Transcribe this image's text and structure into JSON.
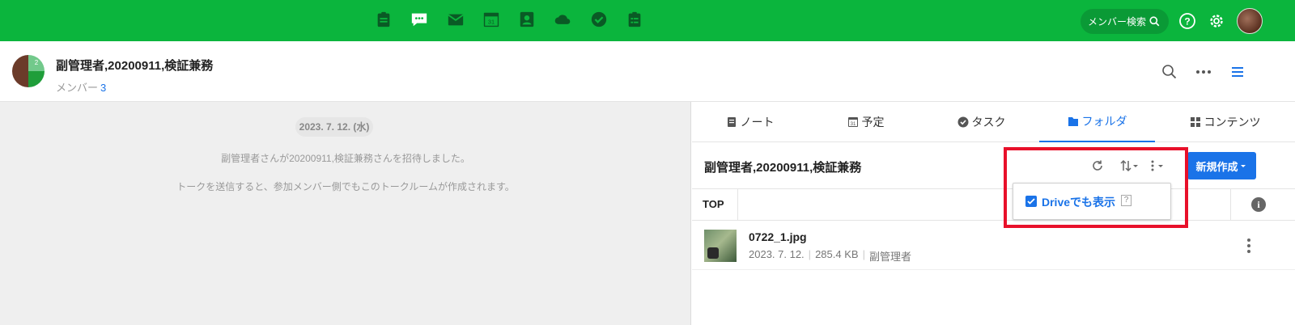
{
  "topbar": {
    "apps": [
      "note-app-icon",
      "talk-app-icon",
      "mail-app-icon",
      "calendar-app-icon",
      "contacts-app-icon",
      "drive-app-icon",
      "task-app-icon",
      "form-app-icon"
    ],
    "calendar_day": "31",
    "member_search_label": "メンバー検索",
    "colors": {
      "bar": "#0bb53d",
      "pill": "#0a9a36"
    }
  },
  "room": {
    "title": "副管理者,20200911,検証兼務",
    "member_label": "メンバー",
    "member_count": "3",
    "avatar_badge": "2"
  },
  "chat": {
    "date": "2023. 7. 12. (水)",
    "messages": [
      "副管理者さんが20200911,検証兼務さんを招待しました。",
      "トークを送信すると、参加メンバー側でもこのトークルームが作成されます。"
    ]
  },
  "tabs": [
    {
      "label": "ノート",
      "icon": "note-icon",
      "active": false
    },
    {
      "label": "予定",
      "icon": "calendar-icon",
      "active": false
    },
    {
      "label": "タスク",
      "icon": "check-circle-icon",
      "active": false
    },
    {
      "label": "フォルダ",
      "icon": "folder-icon",
      "active": true
    },
    {
      "label": "コンテンツ",
      "icon": "grid-icon",
      "active": false
    }
  ],
  "folder": {
    "title": "副管理者,20200911,検証兼務",
    "new_button": "新規作成",
    "breadcrumb": "TOP",
    "dropdown": {
      "option_label": "Driveでも表示",
      "checked": true,
      "help": "?"
    },
    "files": [
      {
        "name": "0722_1.jpg",
        "date": "2023. 7. 12.",
        "size": "285.4 KB",
        "owner": "副管理者"
      }
    ]
  },
  "accent": "#1a73e8",
  "highlight_color": "#e8102a"
}
